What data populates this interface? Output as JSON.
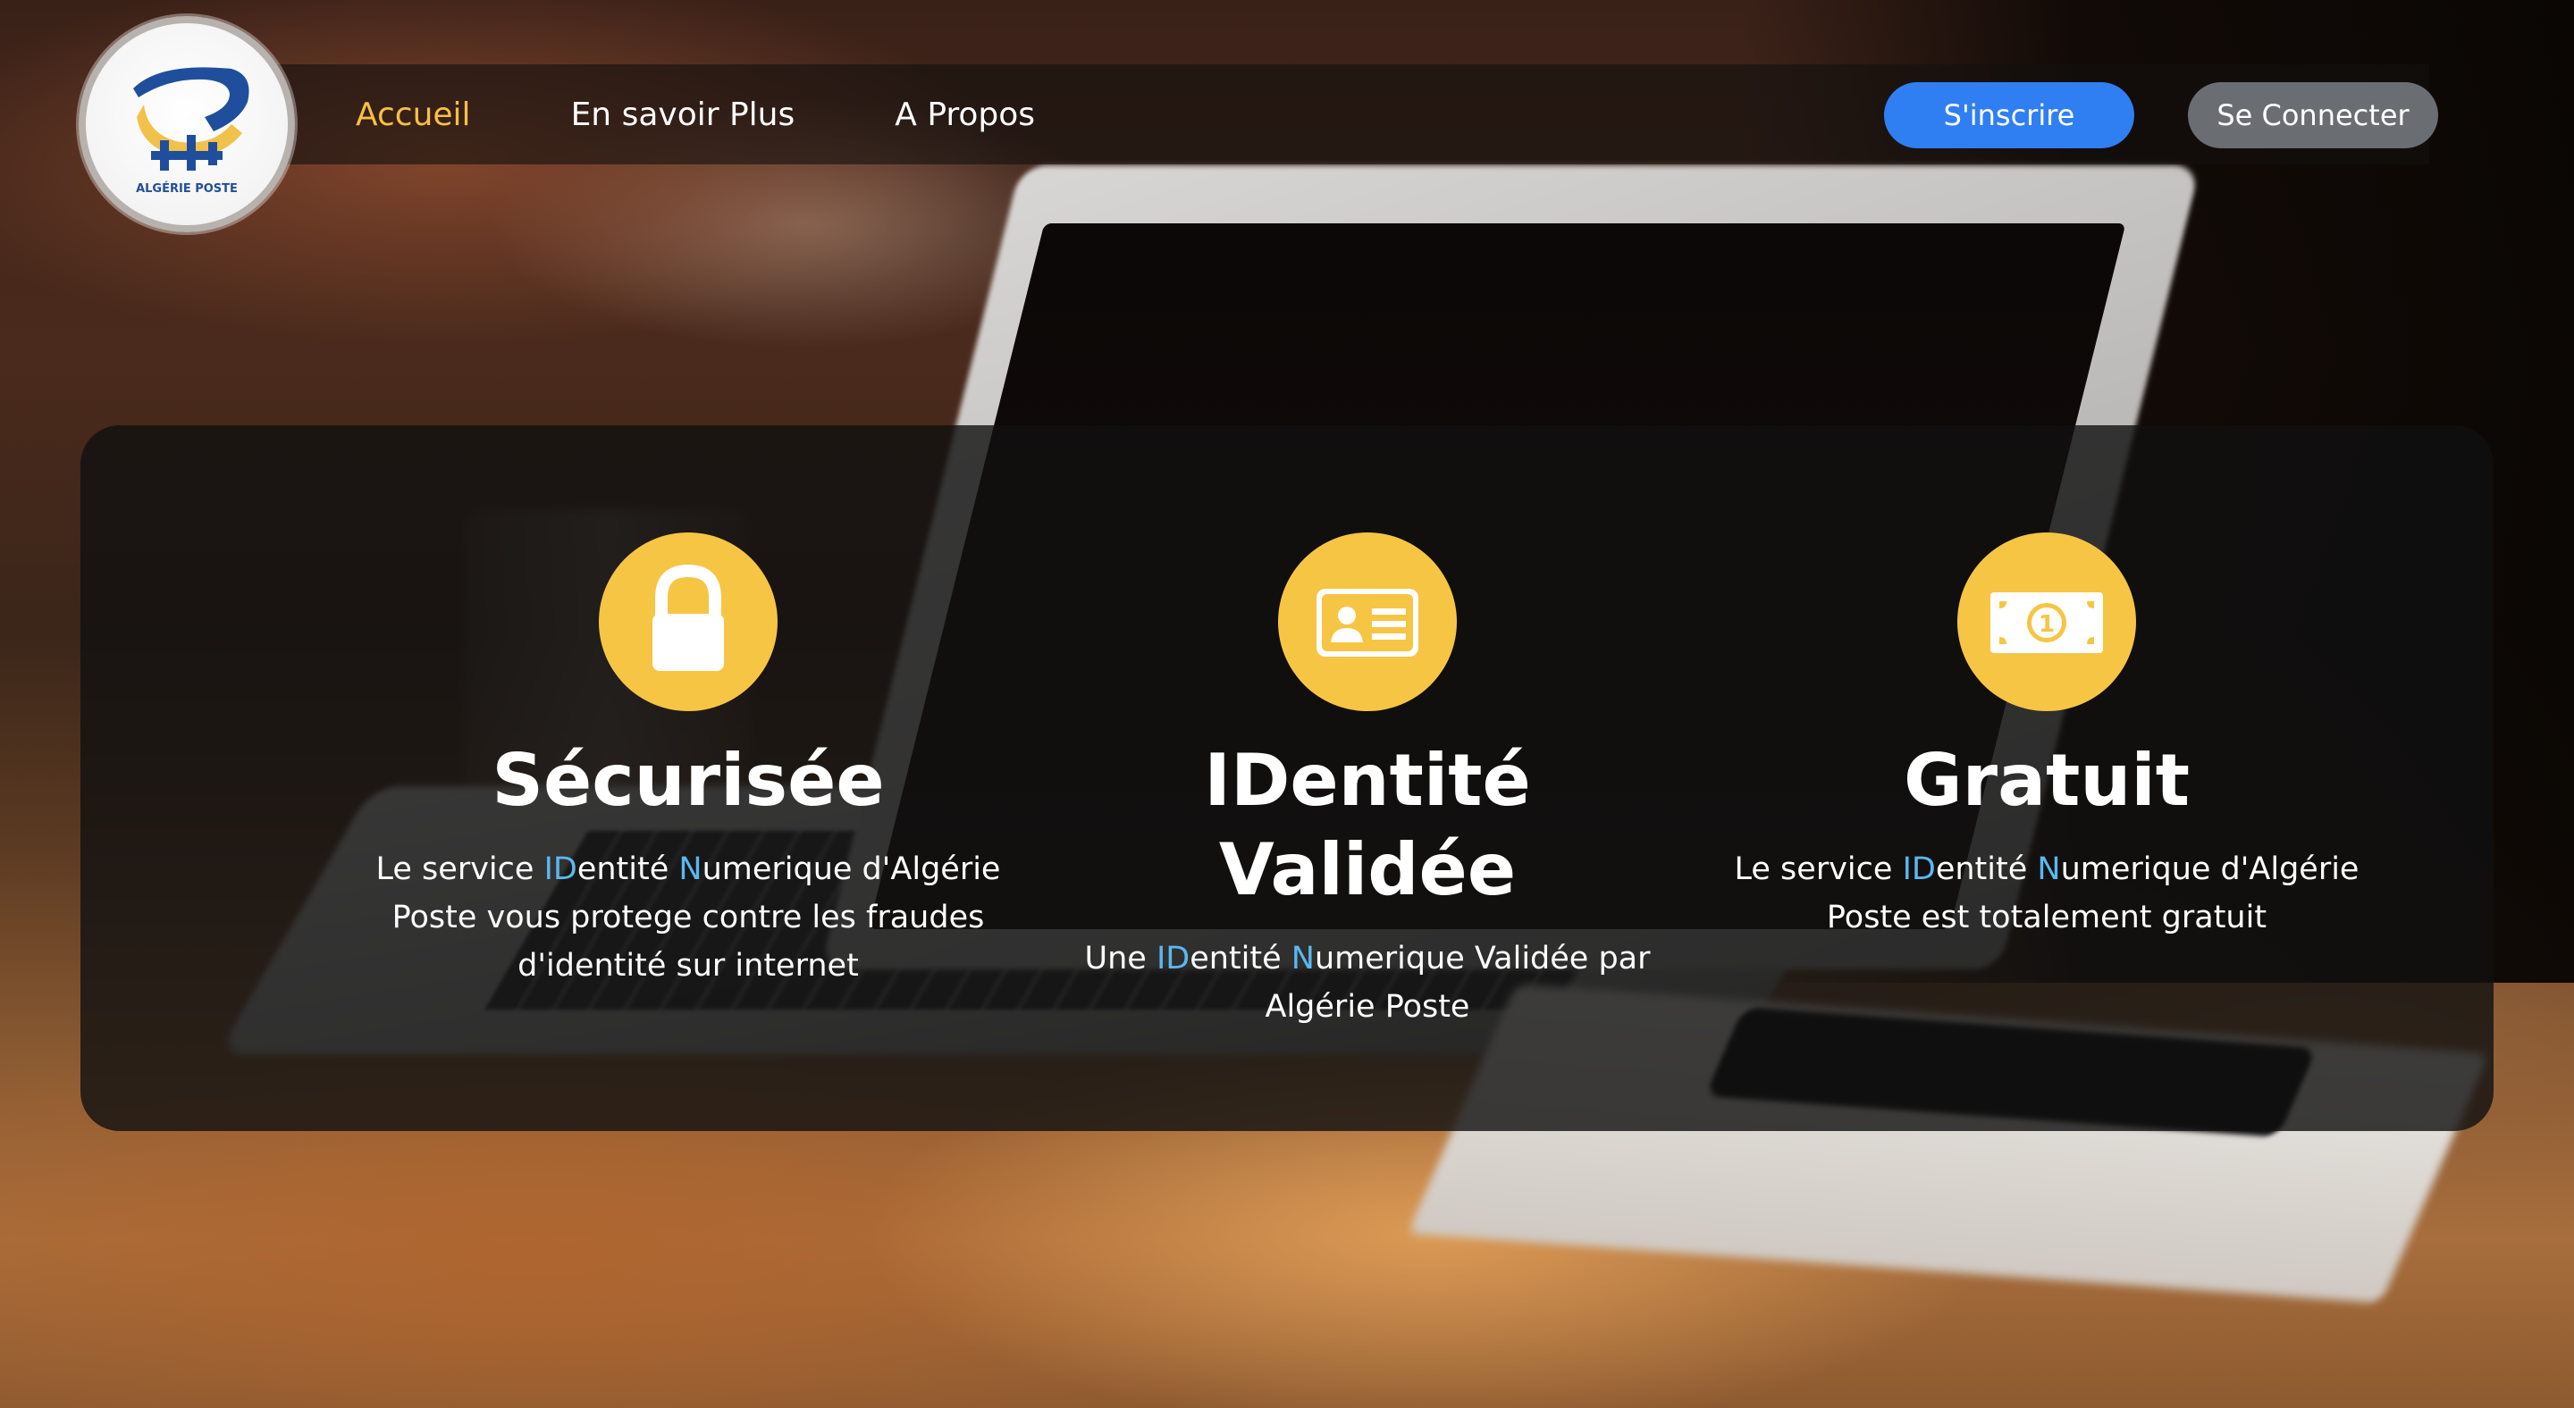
{
  "brand": {
    "logo_text": "ALGÉRIE POSTE",
    "logo_icon": "algerie-poste-logo"
  },
  "nav": {
    "items": [
      {
        "label": "Accueil",
        "active": true
      },
      {
        "label": "En savoir Plus",
        "active": false
      },
      {
        "label": "A Propos",
        "active": false
      }
    ],
    "register_label": "S'inscrire",
    "login_label": "Se Connecter"
  },
  "features": [
    {
      "icon": "lock-icon",
      "title": "Sécurisée",
      "desc_before": "Le service ",
      "hl1": "ID",
      "desc_mid1": "entité ",
      "hl2": "N",
      "desc_after": "umerique d'Algérie Poste vous protege contre les fraudes d'identité sur internet"
    },
    {
      "icon": "id-card-icon",
      "title": "IDentité Validée",
      "desc_before": "Une ",
      "hl1": "ID",
      "desc_mid1": "entité ",
      "hl2": "N",
      "desc_after": "umerique Validée par Algérie Poste"
    },
    {
      "icon": "banknote-icon",
      "title": "Gratuit",
      "desc_before": "Le service ",
      "hl1": "ID",
      "desc_mid1": "entité ",
      "hl2": "N",
      "desc_after": "umerique d'Algérie Poste est totalement gratuit"
    }
  ],
  "colors": {
    "accent_yellow": "#f7c544",
    "active_nav": "#f7c044",
    "highlight_blue": "#5ab8f0",
    "register_blue": "#2f7ff2",
    "login_gray": "#6a6e73"
  }
}
